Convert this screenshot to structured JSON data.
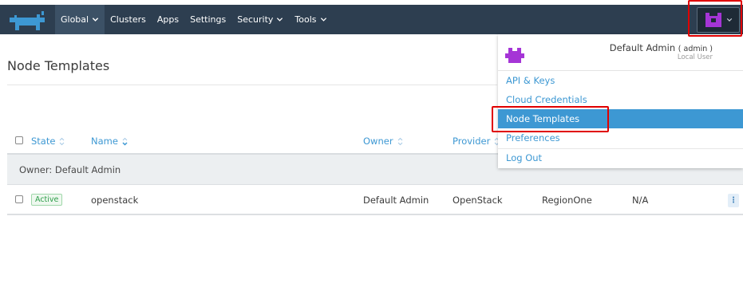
{
  "nav": {
    "items": [
      {
        "label": "Global",
        "has_caret": true,
        "active": true
      },
      {
        "label": "Clusters",
        "has_caret": false,
        "active": false
      },
      {
        "label": "Apps",
        "has_caret": false,
        "active": false
      },
      {
        "label": "Settings",
        "has_caret": false,
        "active": false
      },
      {
        "label": "Security",
        "has_caret": true,
        "active": false
      },
      {
        "label": "Tools",
        "has_caret": true,
        "active": false
      }
    ],
    "logo_icon": "rancher-cow-logo",
    "avatar_icon": "identicon-avatar",
    "avatar_caret_icon": "chevron-down-icon"
  },
  "page": {
    "title": "Node Templates"
  },
  "table": {
    "columns": {
      "state": "State",
      "name": "Name",
      "owner": "Owner",
      "provider": "Provider"
    },
    "group_label": "Owner: Default Admin",
    "rows": [
      {
        "state": "Active",
        "name": "openstack",
        "owner": "Default Admin",
        "provider": "OpenStack",
        "region": "RegionOne",
        "extra": "N/A",
        "action_icon": "kebab-menu-icon"
      }
    ]
  },
  "user_menu": {
    "display_name": "Default Admin",
    "username": "( admin )",
    "role": "Local User",
    "items": [
      {
        "label": "API & Keys",
        "selected": false
      },
      {
        "label": "Cloud Credentials",
        "selected": false
      },
      {
        "label": "Node Templates",
        "selected": true
      },
      {
        "label": "Preferences",
        "selected": false
      },
      {
        "label": "Log Out",
        "selected": false
      }
    ]
  },
  "colors": {
    "navbar": "#2d3e50",
    "link": "#3d98d3",
    "avatar": "#a535d6",
    "highlight": "#e00000",
    "active_badge": "#2e9e4a"
  }
}
